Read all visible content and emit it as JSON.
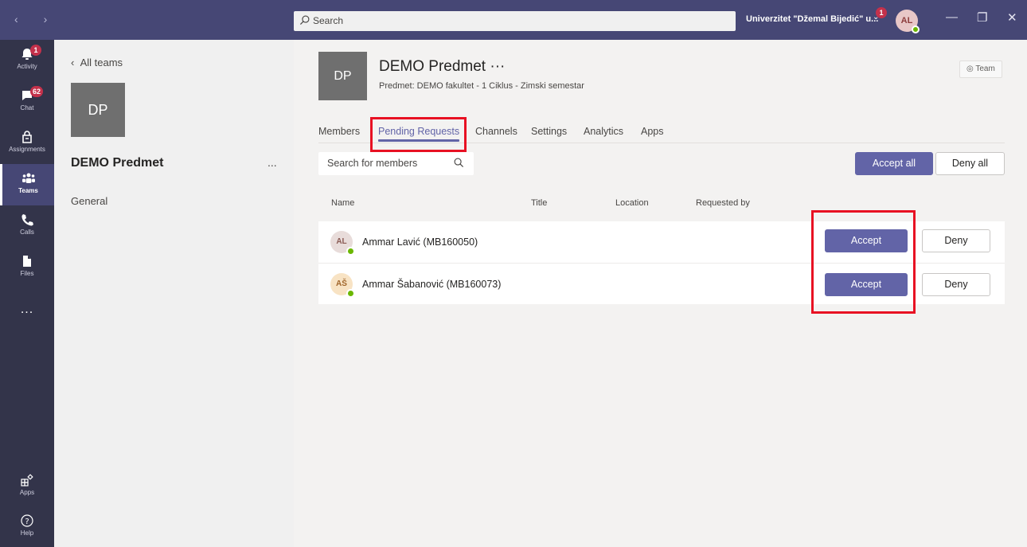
{
  "titlebar": {
    "search_placeholder": "Search",
    "org_name": "Univerzitet \"Džemal Bijedić\" u...",
    "org_badge": "1",
    "user_initials": "AL",
    "back_arrow": "‹",
    "forward_arrow": "›",
    "minimize": "—",
    "maximize": "❐",
    "close": "✕"
  },
  "rail": {
    "items": [
      {
        "label": "Activity",
        "icon": "bell-icon",
        "badge": "1"
      },
      {
        "label": "Chat",
        "icon": "chat-icon",
        "badge": "62"
      },
      {
        "label": "Assignments",
        "icon": "assignments-icon"
      },
      {
        "label": "Teams",
        "icon": "teams-icon",
        "active": true
      },
      {
        "label": "Calls",
        "icon": "phone-icon"
      },
      {
        "label": "Files",
        "icon": "file-icon"
      }
    ],
    "more": "...",
    "apps_label": "Apps",
    "help_label": "Help"
  },
  "teams_panel": {
    "back_label": "All teams",
    "team_initials": "DP",
    "team_name": "DEMO Predmet",
    "more": "...",
    "channels": [
      "General"
    ]
  },
  "header": {
    "initials": "DP",
    "title": "DEMO Predmet ···",
    "subtitle": "Predmet: DEMO fakultet - 1 Ciklus - Zimski semestar",
    "team_chip": "Team"
  },
  "tabs": [
    {
      "label": "Members"
    },
    {
      "label": "Pending Requests",
      "active": true
    },
    {
      "label": "Channels"
    },
    {
      "label": "Settings"
    },
    {
      "label": "Analytics"
    },
    {
      "label": "Apps"
    }
  ],
  "toolbar": {
    "search_placeholder": "Search for members",
    "accept_all": "Accept all",
    "deny_all": "Deny all"
  },
  "columns": [
    "Name",
    "Title",
    "Location",
    "Requested by"
  ],
  "requests": [
    {
      "initials": "AL",
      "name": "Ammar Lavić (MB160050)",
      "accept": "Accept",
      "deny": "Deny",
      "avatar_bg": "#e8dcda",
      "avatar_fg": "#8a5b54"
    },
    {
      "initials": "AŠ",
      "name": "Ammar Šabanović (MB160073)",
      "accept": "Accept",
      "deny": "Deny",
      "avatar_bg": "#f8e3c4",
      "avatar_fg": "#a0652a"
    }
  ],
  "colors": {
    "brand": "#6264a7",
    "titlebar": "#464775",
    "rail": "#33344a",
    "highlight": "#e81123",
    "badge": "#c4314b",
    "presence": "#6bb700"
  }
}
